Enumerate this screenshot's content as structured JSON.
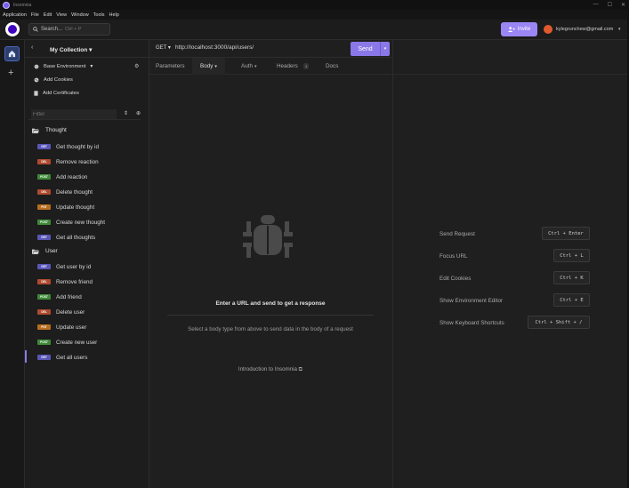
{
  "window": {
    "title": "Insomnia",
    "controls": [
      "—",
      "☐",
      "✕"
    ]
  },
  "menu": [
    "Application",
    "File",
    "Edit",
    "View",
    "Window",
    "Tools",
    "Help"
  ],
  "header": {
    "search_label": "Search...",
    "search_shortcut": "Ctrl + P",
    "invite_label": "Invite",
    "user_email": "kylegrunchew@gmail.com"
  },
  "sidebar": {
    "collection_title": "My Collection",
    "environment": "Base Environment",
    "add_cookies": "Add Cookies",
    "add_certificates": "Add Certificates",
    "filter_placeholder": "Filter",
    "folders": [
      {
        "name": "Thought",
        "requests": [
          {
            "method": "GET",
            "name": "Get thought by id"
          },
          {
            "method": "DEL",
            "name": "Remove reaction"
          },
          {
            "method": "POST",
            "name": "Add reaction"
          },
          {
            "method": "DEL",
            "name": "Delete thought"
          },
          {
            "method": "PUT",
            "name": "Update thought"
          },
          {
            "method": "POST",
            "name": "Create new thought"
          },
          {
            "method": "GET",
            "name": "Get all thoughts"
          }
        ]
      },
      {
        "name": "User",
        "requests": [
          {
            "method": "GET",
            "name": "Get user by id"
          },
          {
            "method": "DEL",
            "name": "Remove friend"
          },
          {
            "method": "POST",
            "name": "Add friend"
          },
          {
            "method": "DEL",
            "name": "Delete user"
          },
          {
            "method": "PUT",
            "name": "Update user"
          },
          {
            "method": "POST",
            "name": "Create new user"
          },
          {
            "method": "GET",
            "name": "Get all users"
          }
        ]
      }
    ]
  },
  "request": {
    "method": "GET",
    "url": "http://localhost:3000/api/users/",
    "send_label": "Send",
    "tabs": [
      "Parameters",
      "Body",
      "Auth",
      "Headers",
      "Docs"
    ],
    "headers_count": "1",
    "empty_title": "Enter a URL and send to get a response",
    "empty_subtitle": "Select a body type from above to send data in the body of a request",
    "intro_link": "Introduction to Insomnia"
  },
  "response": {
    "shortcuts": [
      {
        "label": "Send Request",
        "keys": "Ctrl + Enter"
      },
      {
        "label": "Focus URL",
        "keys": "Ctrl + L"
      },
      {
        "label": "Edit Cookies",
        "keys": "Ctrl + K"
      },
      {
        "label": "Show Environment Editor",
        "keys": "Ctrl + E"
      },
      {
        "label": "Show Keyboard Shortcuts",
        "keys": "Ctrl + Shift + /"
      }
    ]
  },
  "colors": {
    "accent": "#8a78e8",
    "get": "#5a56b8",
    "post": "#3f8a3a",
    "put": "#b86e1e",
    "delete": "#b04a2e"
  }
}
